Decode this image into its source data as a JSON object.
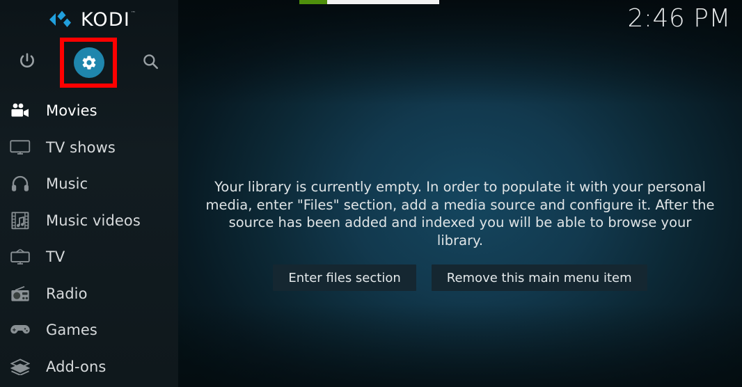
{
  "app": {
    "name": "KODI",
    "trademark": "™"
  },
  "topbar": {
    "clock": "2:46 PM",
    "progress": {
      "segment_green_color": "#4f8f0c",
      "segment_white_color": "#f2f2f2"
    }
  },
  "sidebar": {
    "quick_icons": [
      {
        "name": "power-icon",
        "label": "Power"
      },
      {
        "name": "settings-gear-icon",
        "label": "Settings",
        "active": true,
        "accent": "#1f86ad"
      },
      {
        "name": "search-icon",
        "label": "Search"
      }
    ],
    "items": [
      {
        "label": "Movies",
        "icon": "movie-camera-icon",
        "selected": true
      },
      {
        "label": "TV shows",
        "icon": "tv-monitor-icon",
        "selected": false
      },
      {
        "label": "Music",
        "icon": "headphones-icon",
        "selected": false
      },
      {
        "label": "Music videos",
        "icon": "film-strip-note-icon",
        "selected": false
      },
      {
        "label": "TV",
        "icon": "retro-tv-icon",
        "selected": false
      },
      {
        "label": "Radio",
        "icon": "radio-icon",
        "selected": false
      },
      {
        "label": "Games",
        "icon": "gamepad-icon",
        "selected": false
      },
      {
        "label": "Add-ons",
        "icon": "addons-box-icon",
        "selected": false
      }
    ]
  },
  "main": {
    "empty_message": "Your library is currently empty. In order to populate it with your personal media, enter \"Files\" section, add a media source and configure it. After the source has been added and indexed you will be able to browse your library.",
    "buttons": [
      {
        "label": "Enter files section",
        "name": "enter-files-section-button"
      },
      {
        "label": "Remove this main menu item",
        "name": "remove-main-menu-item-button"
      }
    ]
  },
  "annotation": {
    "highlight_color": "#fe0000",
    "target": "settings-gear-icon"
  }
}
